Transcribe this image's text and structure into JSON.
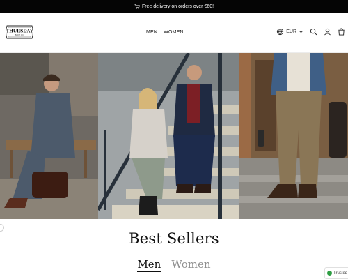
{
  "announcement": {
    "text": "Free delivery on orders over €60!"
  },
  "brand": {
    "logo_top": "THURSDAY",
    "logo_bottom": "BOOT CO."
  },
  "nav": {
    "men": "MEN",
    "women": "WOMEN"
  },
  "header_tools": {
    "currency": "EUR",
    "icons": [
      "globe-icon",
      "chevron-down-icon",
      "search-icon",
      "account-icon",
      "cart-icon"
    ]
  },
  "hero": {
    "panels": [
      "hero-image-man-on-bench",
      "hero-image-couple-on-stairs",
      "hero-image-man-standing"
    ]
  },
  "best_sellers": {
    "title": "Best Sellers",
    "tabs": [
      {
        "label": "Men",
        "active": true
      },
      {
        "label": "Women",
        "active": false
      }
    ]
  },
  "trust_badge": {
    "text": "Trusted"
  },
  "colors": {
    "announcement_bg": "#050505",
    "text": "#111111",
    "inactive_tab": "#8f8f8f",
    "trust_green": "#2f9e44"
  }
}
